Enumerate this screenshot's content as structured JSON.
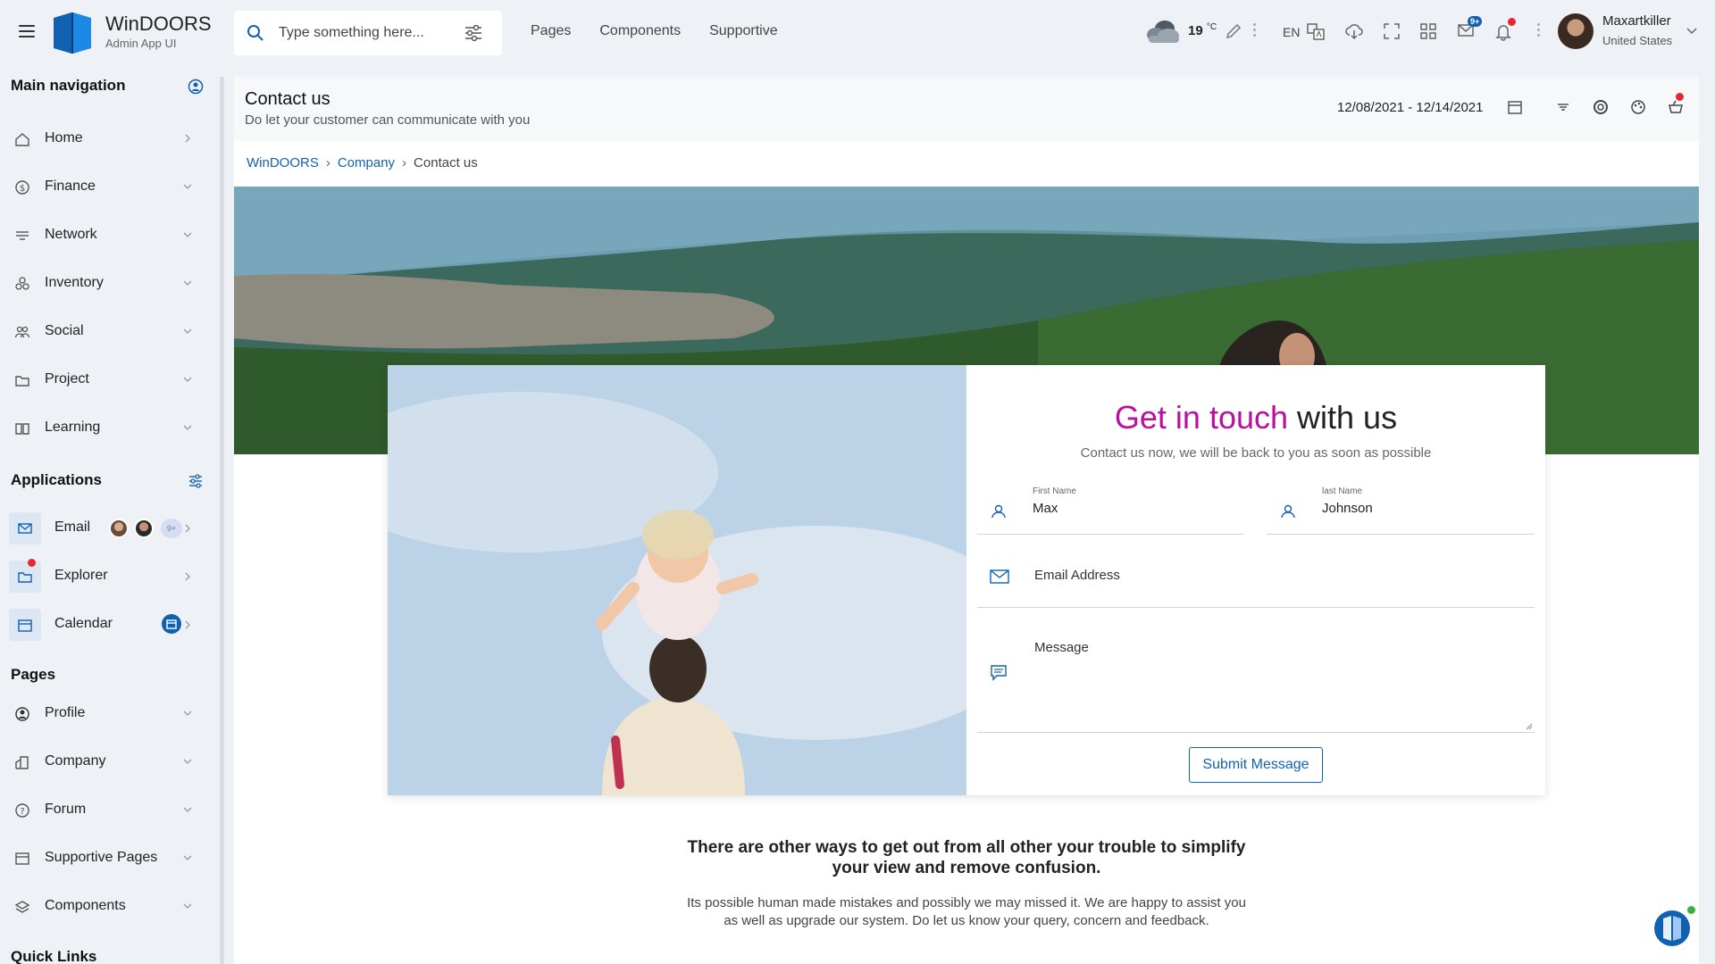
{
  "app": {
    "name": "WinDOORS",
    "subtitle": "Admin App UI"
  },
  "search": {
    "placeholder": "Type something here..."
  },
  "topnav": [
    "Pages",
    "Components",
    "Supportive"
  ],
  "header": {
    "temperature": "19",
    "temp_unit": "°C",
    "language": "EN",
    "notification_badge": "9+",
    "user_name": "Maxartkiller",
    "user_country": "United States"
  },
  "sidebar": {
    "main_heading": "Main navigation",
    "main_items": [
      {
        "label": "Home",
        "icon": "home-icon"
      },
      {
        "label": "Finance",
        "icon": "dollar-icon"
      },
      {
        "label": "Network",
        "icon": "network-icon"
      },
      {
        "label": "Inventory",
        "icon": "boxes-icon"
      },
      {
        "label": "Social",
        "icon": "people-icon"
      },
      {
        "label": "Project",
        "icon": "folder-icon"
      },
      {
        "label": "Learning",
        "icon": "book-icon"
      }
    ],
    "apps_heading": "Applications",
    "apps": [
      {
        "label": "Email",
        "icon": "envelope-icon",
        "badge": "9+"
      },
      {
        "label": "Explorer",
        "icon": "folder-icon"
      },
      {
        "label": "Calendar",
        "icon": "calendar-icon"
      }
    ],
    "pages_heading": "Pages",
    "pages": [
      {
        "label": "Profile",
        "icon": "user-circle-icon"
      },
      {
        "label": "Company",
        "icon": "building-icon"
      },
      {
        "label": "Forum",
        "icon": "question-icon"
      },
      {
        "label": "Supportive Pages",
        "icon": "pages-icon"
      },
      {
        "label": "Components",
        "icon": "layers-icon"
      }
    ],
    "quick_heading": "Quick Links"
  },
  "page": {
    "title": "Contact us",
    "subtitle": "Do let your customer can communicate with you",
    "date_range": "12/08/2021 - 12/14/2021",
    "breadcrumb": [
      "WinDOORS",
      "Company",
      "Contact us"
    ]
  },
  "form": {
    "title_accent": "Get in touch",
    "title_rest": " with us",
    "subtitle": "Contact us now, we will be back to you as soon as possible",
    "first_name_label": "First Name",
    "first_name_value": "Max",
    "last_name_label": "last Name",
    "last_name_value": "Johnson",
    "email_placeholder": "Email Address",
    "message_placeholder": "Message",
    "submit_label": "Submit Message"
  },
  "lower": {
    "title": "There are other ways to get out from all other your trouble to simplify your view and remove confusion.",
    "text": "Its possible human made mistakes and possibly we may missed it. We are happy to assist you as well as upgrade our system. Do let us know your query, concern and feedback."
  },
  "colors": {
    "accent": "#1261b1",
    "title_accent": "#bb0fa0",
    "alert": "#e8262f",
    "online": "#3cb043"
  }
}
